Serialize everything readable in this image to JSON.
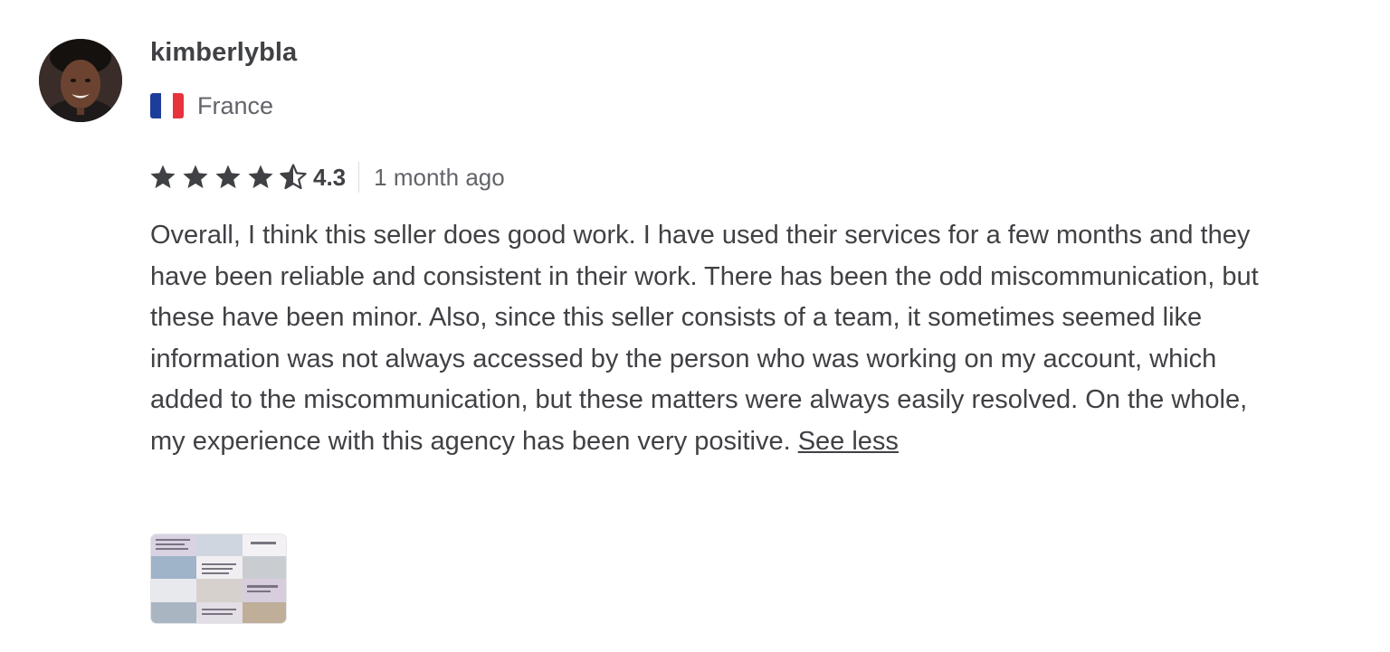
{
  "reviewer": {
    "username": "kimberlybla",
    "country": "France",
    "flag_colors": [
      "#1d3d9b",
      "#ffffff",
      "#e8323c"
    ]
  },
  "rating": {
    "score": "4.3",
    "value": 4.3,
    "max": 5,
    "time_ago": "1 month ago",
    "star_color": "#404145"
  },
  "review": {
    "text": "Overall, I think this seller does good work. I have used their services for a few months and they have been reliable and consistent in their work. There has been the odd miscommunication, but these have been minor. Also, since this seller consists of a team, it sometimes seemed like information was not always accessed by the person who was working on my account, which added to the miscommunication, but these matters were always easily resolved. On the whole, my experience with this agency has been very positive.",
    "see_less_label": "See less"
  },
  "attachment": {
    "icon": "image-thumbnail"
  }
}
